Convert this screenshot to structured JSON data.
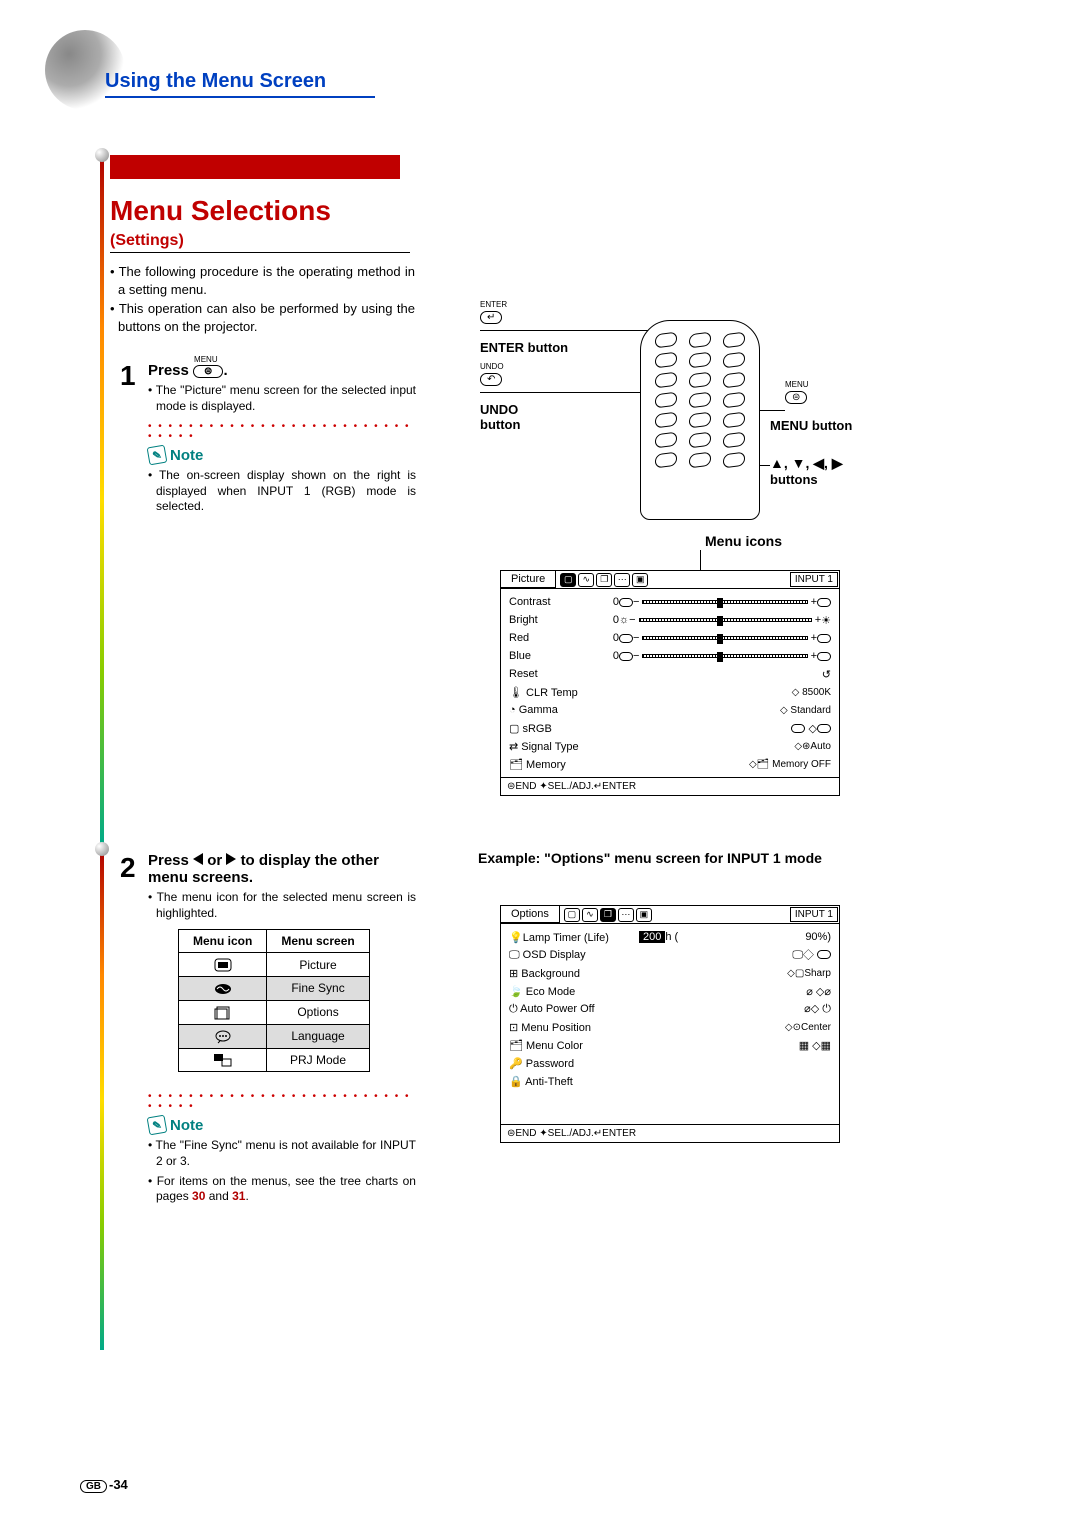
{
  "header": {
    "title": "Using the Menu Screen"
  },
  "main_title": "Menu Selections",
  "subtitle": "(Settings)",
  "intro": {
    "b1": "The following procedure is the operating method in a setting menu.",
    "b2": "This operation can also be performed by using the buttons on the projector."
  },
  "step1": {
    "press": "Press",
    "btn_small_label": "MENU",
    "period": ".",
    "bullet": "The \"Picture\" menu screen for the selected input mode is displayed.",
    "note_label": "Note",
    "note_bullet": "The on-screen display shown on the right is displayed when INPUT 1 (RGB) mode is selected."
  },
  "step2": {
    "press_a": "Press",
    "press_b": "or",
    "press_c": "to display the other menu screens.",
    "bullet": "The menu icon for the selected menu screen is highlighted.",
    "table": {
      "h1": "Menu icon",
      "h2": "Menu screen",
      "rows": [
        "Picture",
        "Fine Sync",
        "Options",
        "Language",
        "PRJ Mode"
      ]
    },
    "note_label": "Note",
    "note_b1": "The \"Fine Sync\" menu is not available for INPUT 2 or 3.",
    "note_b2_a": "For items on the menus, see the tree charts on pages ",
    "note_b2_link1": "30",
    "note_b2_and": " and ",
    "note_b2_link2": "31",
    "note_b2_end": "."
  },
  "remote": {
    "enter_small": "ENTER",
    "enter_label": "ENTER button",
    "undo_small": "UNDO",
    "undo_label_a": "UNDO",
    "undo_label_b": "button",
    "menu_small": "MENU",
    "menu_label": "MENU button",
    "arrows_label": "▲, ▼, ◀, ▶ buttons",
    "menu_icons_label": "Menu icons"
  },
  "osd_picture": {
    "tab": "Picture",
    "input": "INPUT  1",
    "rows": {
      "contrast": "Contrast",
      "contrast_v": "0",
      "bright": "Bright",
      "bright_v": "0",
      "red": "Red",
      "red_v": "0",
      "blue": "Blue",
      "blue_v": "0",
      "reset": "Reset",
      "clr": "CLR Temp",
      "clr_v": "8500K",
      "gamma": "Gamma",
      "gamma_v": "Standard",
      "srgb": "sRGB",
      "signal": "Signal Type",
      "signal_v": "Auto",
      "memory": "Memory",
      "memory_v": "Memory OFF"
    },
    "footer": "⊜END ✦SEL./ADJ.↵ENTER"
  },
  "example_label": "Example: \"Options\" menu screen for INPUT 1 mode",
  "osd_options": {
    "tab": "Options",
    "input": "INPUT  1",
    "rows": {
      "lamp": "Lamp Timer (Life)",
      "lamp_h": "200",
      "lamp_hu": "h (",
      "lamp_p": "90%)",
      "osd": "OSD Display",
      "bg": "Background",
      "bg_v": "Sharp",
      "eco": "Eco Mode",
      "auto": "Auto Power Off",
      "pos": "Menu Position",
      "pos_v": "Center",
      "color": "Menu Color",
      "pw": "Password",
      "anti": "Anti-Theft"
    },
    "footer": "⊜END ✦SEL./ADJ.↵ENTER"
  },
  "page_footer": {
    "badge": "GB",
    "num": "-34"
  }
}
